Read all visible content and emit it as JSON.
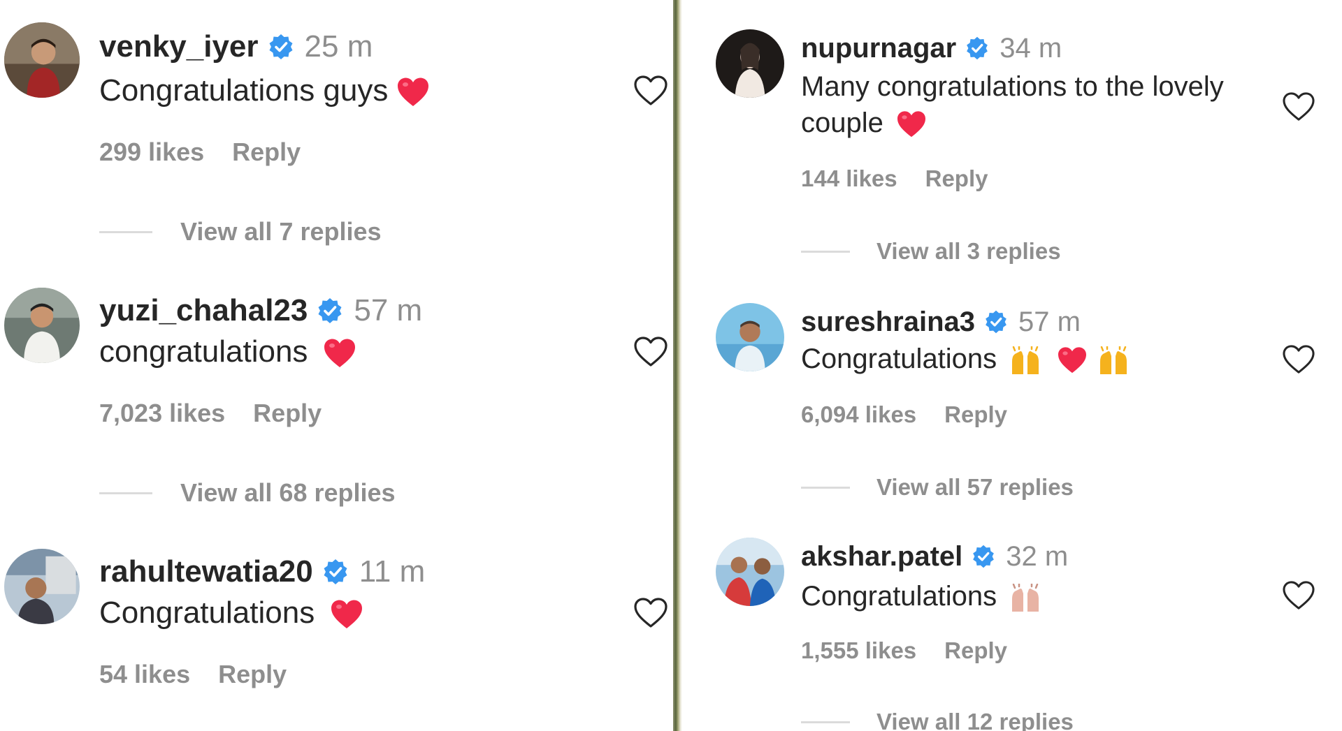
{
  "colors": {
    "verified": "#3897f0",
    "heart": "#f0284a",
    "muted": "#8e8e8e",
    "text": "#262626"
  },
  "left_panel": {
    "comments": [
      {
        "username": "venky_iyer",
        "verified_icon": "verified-badge-icon",
        "time": "25 m",
        "text": "Congratulations guys",
        "emojis": [
          "red-heart"
        ],
        "likes": "299 likes",
        "reply_label": "Reply",
        "view_replies": "View all 7 replies"
      },
      {
        "username": "yuzi_chahal23",
        "verified_icon": "verified-badge-icon",
        "time": "57 m",
        "text": "congratulations",
        "emojis": [
          "red-heart"
        ],
        "likes": "7,023 likes",
        "reply_label": "Reply",
        "view_replies": "View all 68 replies"
      },
      {
        "username": "rahultewatia20",
        "verified_icon": "verified-badge-icon",
        "time": "11 m",
        "text": "Congratulations",
        "emojis": [
          "red-heart"
        ],
        "likes": "54 likes",
        "reply_label": "Reply"
      }
    ]
  },
  "right_panel": {
    "comments": [
      {
        "username": "nupurnagar",
        "verified_icon": "verified-badge-icon",
        "time": "34 m",
        "text_line1": "Many congratulations to the lovely",
        "text_line2": "couple",
        "emojis": [
          "red-heart"
        ],
        "likes": "144 likes",
        "reply_label": "Reply",
        "view_replies": "View all 3 replies"
      },
      {
        "username": "sureshraina3",
        "verified_icon": "verified-badge-icon",
        "time": "57 m",
        "text": "Congratulations",
        "emojis": [
          "raising-hands",
          "red-heart",
          "raising-hands"
        ],
        "likes": "6,094 likes",
        "reply_label": "Reply",
        "view_replies": "View all 57 replies"
      },
      {
        "username": "akshar.patel",
        "verified_icon": "verified-badge-icon",
        "time": "32 m",
        "text": "Congratulations",
        "emojis": [
          "raising-hands-light"
        ],
        "likes": "1,555 likes",
        "reply_label": "Reply",
        "view_replies": "View all 12 replies"
      }
    ]
  }
}
